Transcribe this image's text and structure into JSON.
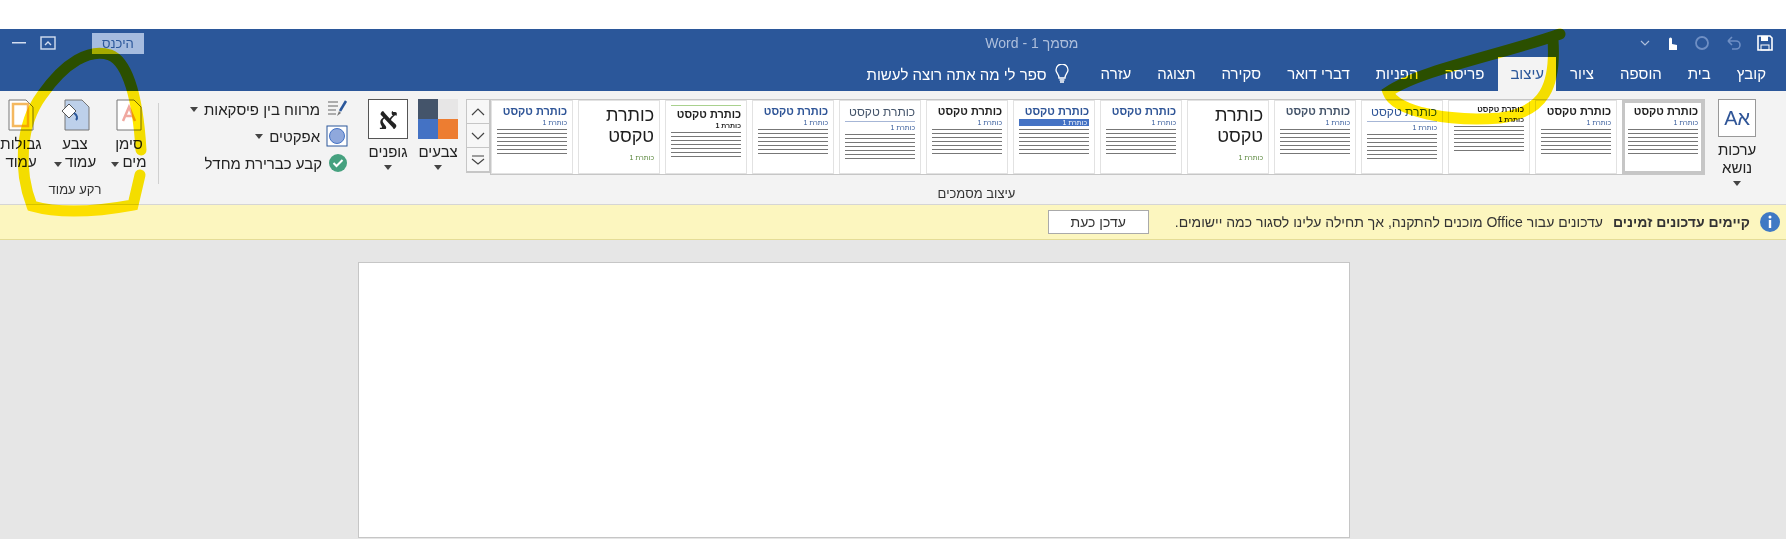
{
  "window": {
    "title": "מסמך 1 - Word",
    "sign_in": "היכנס"
  },
  "tabs": [
    {
      "label": "קובץ",
      "selected": false
    },
    {
      "label": "בית",
      "selected": false
    },
    {
      "label": "הוספה",
      "selected": false
    },
    {
      "label": "ציור",
      "selected": false
    },
    {
      "label": "עיצוב",
      "selected": true
    },
    {
      "label": "פריסה",
      "selected": false
    },
    {
      "label": "הפניות",
      "selected": false
    },
    {
      "label": "דברי דואר",
      "selected": false
    },
    {
      "label": "סקירה",
      "selected": false
    },
    {
      "label": "תצוגה",
      "selected": false
    },
    {
      "label": "עזרה",
      "selected": false
    }
  ],
  "tell_me": "ספר לי מה אתה רוצה לעשות",
  "ribbon": {
    "themes": {
      "label": "ערכות נושא",
      "icon_text": "Aא"
    },
    "style_gallery": [
      {
        "kind": "plain",
        "title": "כותרת טקסט",
        "heading": "כותרת 1",
        "color": "#1f1f1f",
        "selected": true
      },
      {
        "kind": "plain",
        "title": "כותרת טקסט",
        "heading": "כותרת 1",
        "color": "#1f1f1f",
        "selected": false
      },
      {
        "kind": "small",
        "title": "כותרת טקסט",
        "heading": "כותרת 1",
        "color": "#1f1f1f",
        "selected": false
      },
      {
        "kind": "underlined",
        "title": "כותרת טקסט",
        "heading": "כותרת 1",
        "color": "#2f5597",
        "selected": false
      },
      {
        "kind": "plain",
        "title": "כותרת טקסט",
        "heading": "כותרת 1",
        "color": "#44546a",
        "selected": false
      },
      {
        "kind": "large",
        "title": "כותרת טקסט",
        "heading": "כותרת 1",
        "color": "#1f1f1f",
        "selected": false
      },
      {
        "kind": "plain",
        "title": "כותרת טקסט",
        "heading": "כותרת 1",
        "color": "#2f5597",
        "selected": false
      },
      {
        "kind": "banner",
        "title": "כותרת טקסט",
        "heading": "כותרת 1",
        "color": "#2f5597",
        "selected": false
      },
      {
        "kind": "plain",
        "title": "כותרת טקסט",
        "heading": "כותרת 1",
        "color": "#1f1f1f",
        "selected": false
      },
      {
        "kind": "underlined",
        "title": "כותרת טקסט",
        "heading": "כותרת 1",
        "color": "#44546a",
        "selected": false
      },
      {
        "kind": "plain",
        "title": "כותרת טקסט",
        "heading": "כותרת 1",
        "color": "#2f5597",
        "selected": false
      },
      {
        "kind": "topline",
        "title": "כותרת טקסט",
        "heading": "כותרת 1",
        "color": "#1f1f1f",
        "selected": false
      },
      {
        "kind": "large",
        "title": "כותרת טקסט",
        "heading": "כותרת 1",
        "color": "#1f1f1f",
        "selected": false
      },
      {
        "kind": "plain",
        "title": "כותרת טקסט",
        "heading": "כותרת 1",
        "color": "#2f5597",
        "selected": false
      }
    ],
    "document_formatting_label": "עיצוב מסמכים",
    "colors": {
      "label": "צבעים"
    },
    "fonts": {
      "label": "גופנים",
      "icon_text": "א"
    },
    "options": [
      {
        "kind": "spacing",
        "label": "מרווח בין פיסקאות",
        "dropdown": true
      },
      {
        "kind": "effects",
        "label": "אפקטים",
        "dropdown": true
      },
      {
        "kind": "default",
        "label": "קבע כברירת מחדל",
        "dropdown": false
      }
    ],
    "page_background": {
      "label": "רקע עמוד",
      "buttons": [
        {
          "kind": "watermark",
          "label": "סימן מים",
          "dropdown": true
        },
        {
          "kind": "fill",
          "label": "צבע עמוד",
          "dropdown": true
        },
        {
          "kind": "border",
          "label": "גבולות עמוד",
          "dropdown": false
        }
      ]
    }
  },
  "message_bar": {
    "title": "קיימים עדכונים זמינים",
    "text": "עדכונים עבור Office מוכנים להתקנה, אך תחילה עלינו לסגור כמה יישומים.",
    "button": "עדכן כעת"
  }
}
